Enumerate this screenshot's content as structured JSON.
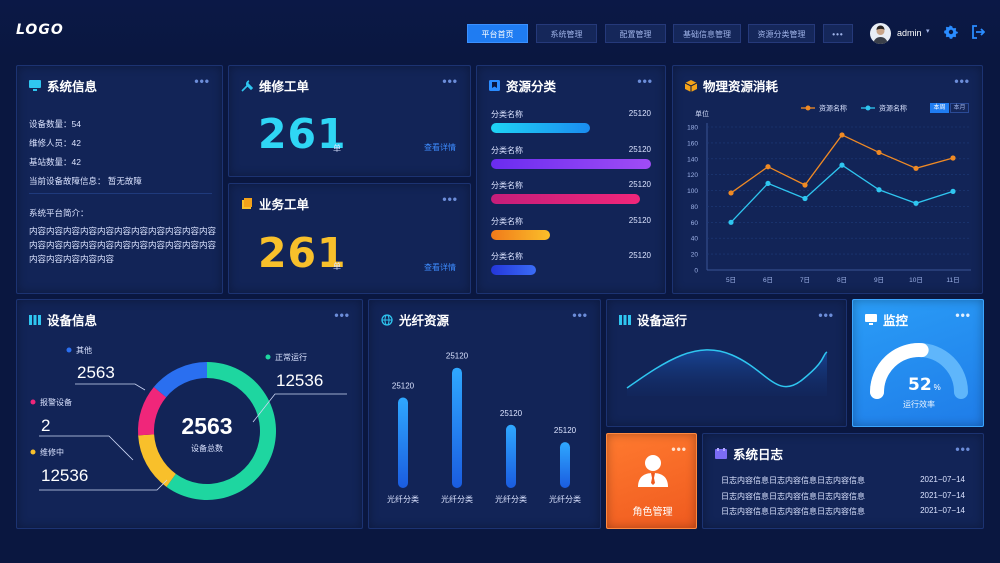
{
  "header": {
    "logo": "LOGO",
    "nav": [
      "平台首页",
      "系统管理",
      "配置管理",
      "基础信息管理",
      "资源分类管理",
      "•••"
    ],
    "user": "admin"
  },
  "sys": {
    "title": "系统信息",
    "dots": "•••",
    "lines": [
      "设备数量：54",
      "维修人员：42",
      "基站数量：42",
      "当前设备故障信息：  暂无故障"
    ],
    "intro_label": "系统平台简介：",
    "intro": "内容内容内容内容内容内容内容内容内容内容内容内容内容内容内容内容内容内容内容内容内容内容内容内容内容内容内容"
  },
  "repair": {
    "title": "维修工单",
    "dots": "•••",
    "value": "261",
    "unit": "单",
    "link": "查看详情"
  },
  "business": {
    "title": "业务工单",
    "dots": "•••",
    "value": "261",
    "unit": "单",
    "link": "查看详情"
  },
  "res": {
    "title": "资源分类",
    "dots": "•••",
    "items": [
      {
        "name": "分类名称",
        "value": "25120",
        "frac": 0.62,
        "c1": "#1fd4f5",
        "c2": "#1a8cf0"
      },
      {
        "name": "分类名称",
        "value": "25120",
        "frac": 1.0,
        "c1": "#6a2cf0",
        "c2": "#a04cf5"
      },
      {
        "name": "分类名称",
        "value": "25120",
        "frac": 0.93,
        "c1": "#c51e7a",
        "c2": "#f0267a"
      },
      {
        "name": "分类名称",
        "value": "25120",
        "frac": 0.37,
        "c1": "#f07a1a",
        "c2": "#fbbf2a"
      },
      {
        "name": "分类名称",
        "value": "25120",
        "frac": 0.28,
        "c1": "#2436d8",
        "c2": "#3a6cf5"
      }
    ]
  },
  "phys": {
    "title": "物理资源消耗",
    "dots": "•••",
    "unit": "单位",
    "toggle": [
      "本周",
      "本月"
    ]
  },
  "chart_data": {
    "type": "line",
    "categories": [
      "5日",
      "6日",
      "7日",
      "8日",
      "9日",
      "10日",
      "11日"
    ],
    "ylim": [
      0,
      180
    ],
    "yticks": [
      0,
      20,
      40,
      60,
      80,
      100,
      120,
      140,
      160,
      180
    ],
    "series": [
      {
        "name": "资源名称",
        "color": "#f08a24",
        "values": [
          97,
          130,
          107,
          170,
          148,
          128,
          141
        ]
      },
      {
        "name": "资源名称",
        "color": "#2fc6f0",
        "values": [
          60,
          109,
          90,
          132,
          101,
          84,
          99
        ]
      }
    ]
  },
  "dev": {
    "title": "设备信息",
    "dots": "•••",
    "center_value": "2563",
    "center_label": "设备总数",
    "labels": [
      {
        "name": "其他",
        "value": "2563",
        "color": "#2a6ff0"
      },
      {
        "name": "报警设备",
        "value": "2",
        "color": "#f0267a"
      },
      {
        "name": "维修中",
        "value": "12536",
        "color": "#f8c02b"
      },
      {
        "name": "正常运行",
        "value": "12536",
        "color": "#1ed6a0"
      }
    ],
    "donut": [
      {
        "frac": 0.6,
        "color": "#1ed6a0"
      },
      {
        "frac": 0.14,
        "color": "#f8c02b"
      },
      {
        "frac": 0.12,
        "color": "#f0267a"
      },
      {
        "frac": 0.14,
        "color": "#2a6ff0"
      }
    ]
  },
  "fiber": {
    "title": "光纤资源",
    "dots": "•••",
    "bars": [
      {
        "label": "光纤分类",
        "value": "25120",
        "frac": 0.73
      },
      {
        "label": "光纤分类",
        "value": "25120",
        "frac": 0.97
      },
      {
        "label": "光纤分类",
        "value": "25120",
        "frac": 0.51
      },
      {
        "label": "光纤分类",
        "value": "25120",
        "frac": 0.37
      }
    ]
  },
  "run": {
    "title": "设备运行",
    "dots": "•••"
  },
  "mon": {
    "title": "监控",
    "dots": "•••",
    "value": "52",
    "pct": "%",
    "label": "运行效率",
    "level": 0.52
  },
  "role": {
    "dots": "•••",
    "label": "角色管理"
  },
  "log": {
    "title": "系统日志",
    "dots": "•••",
    "rows": [
      {
        "text": "日志内容信息日志内容信息日志内容信息",
        "date": "2021−07−14"
      },
      {
        "text": "日志内容信息日志内容信息日志内容信息",
        "date": "2021−07−14"
      },
      {
        "text": "日志内容信息日志内容信息日志内容信息",
        "date": "2021−07−14"
      }
    ]
  }
}
